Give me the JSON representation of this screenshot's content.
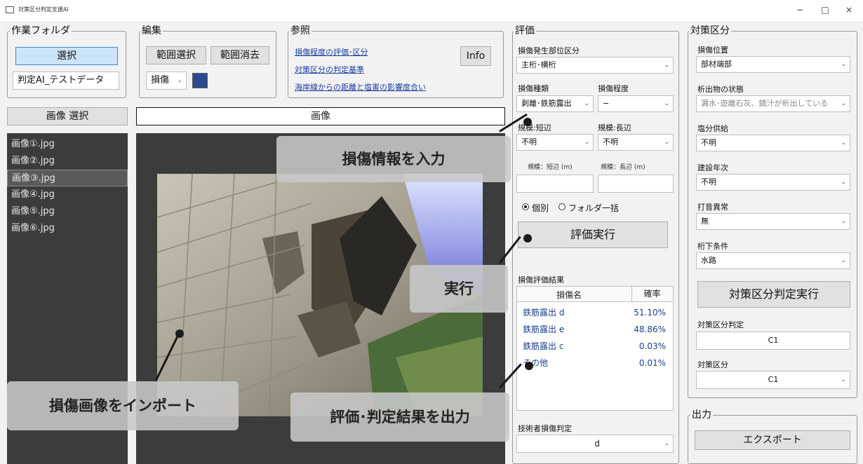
{
  "window": {
    "title": "対策区分判定支援AI",
    "minimize": "−",
    "maximize": "□",
    "close": "×"
  },
  "work_folder": {
    "legend": "作業フォルダ",
    "select_button": "選択",
    "folder_name": "判定AI_テストデータ"
  },
  "edit": {
    "legend": "編集",
    "range_select": "範囲選択",
    "range_clear": "範囲消去",
    "damage_select": "損傷",
    "color_swatch": "#2e4a8f"
  },
  "reference": {
    "legend": "参照",
    "links": [
      "損傷程度の評価･区分",
      "対策区分の判定基準",
      "海岸線からの距離と塩害の影響度合い"
    ],
    "info_button": "Info"
  },
  "image_select_button": "画像 選択",
  "image_header": "画像",
  "image_list": [
    "画像①.jpg",
    "画像②.jpg",
    "画像③.jpg",
    "画像④.jpg",
    "画像⑤.jpg",
    "画像⑥.jpg"
  ],
  "selected_image_index": 2,
  "evaluation": {
    "legend": "評価",
    "location_label": "損傷発生部位区分",
    "location_value": "主桁･横桁",
    "type_label": "損傷種類",
    "type_value": "剥離･鉄筋露出",
    "degree_label": "損傷程度",
    "degree_value": "−",
    "short_label": "規模:短辺",
    "short_value": "不明",
    "long_label": "規模:長辺",
    "long_value": "不明",
    "short_m_label": "規模：短辺 (m)",
    "long_m_label": "規模：長辺 (m)",
    "radio_individual": "個別",
    "radio_folder": "フォルダ一括",
    "run_button": "評価実行",
    "results_label": "損傷評価結果",
    "results_header": {
      "name": "損傷名",
      "prob": "確率"
    },
    "results": [
      {
        "name": "鉄筋露出 d",
        "prob": "51.10%"
      },
      {
        "name": "鉄筋露出 e",
        "prob": "48.86%"
      },
      {
        "name": "鉄筋露出 c",
        "prob": "0.03%"
      },
      {
        "name": "その他",
        "prob": "0.01%"
      }
    ],
    "engineer_label": "技術者損傷判定",
    "engineer_value": "d"
  },
  "countermeasure": {
    "legend": "対策区分",
    "position_label": "損傷位置",
    "position_value": "部材端部",
    "precip_label": "析出物の状態",
    "precip_value": "漏水･遊離石灰、錆汁が析出している",
    "salt_label": "塩分供給",
    "salt_value": "不明",
    "year_label": "建設年次",
    "year_value": "不明",
    "hammer_label": "打音異常",
    "hammer_value": "無",
    "under_label": "桁下条件",
    "under_value": "水路",
    "run_button": "対策区分判定実行",
    "judgement_label": "対策区分判定",
    "judgement_value": "C1",
    "class_label": "対策区分",
    "class_value": "C1"
  },
  "output": {
    "legend": "出力",
    "export_button": "エクスポート"
  },
  "annotations": {
    "input_damage": "損傷情報を入力",
    "execute": "実行",
    "import_image": "損傷画像をインポート",
    "output_results": "評価･判定結果を出力"
  }
}
